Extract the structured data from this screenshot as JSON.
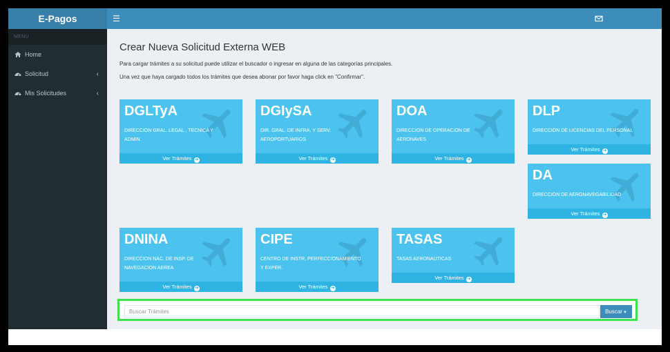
{
  "app": {
    "brand": "E-Pagos"
  },
  "header": {
    "toggle_icon": "hamburger-icon",
    "mail_icon": "envelope-icon"
  },
  "sidebar": {
    "menu_header": "MENU",
    "items": [
      {
        "label": "Home",
        "icon": "home-icon",
        "has_chevron": false
      },
      {
        "label": "Solicitud",
        "icon": "dashboard-icon",
        "has_chevron": true
      },
      {
        "label": "Mis Solicitudes",
        "icon": "dashboard-icon",
        "has_chevron": true
      }
    ],
    "chevron": "‹"
  },
  "main": {
    "title": "Crear Nueva Solicitud Externa WEB",
    "desc1": "Para cargar trámites a su solicitud puede utilizar el buscador o ingresar en alguna de las categorías principales.",
    "desc2": "Una vez que haya cargado todos los trámites que desea abonar por favor haga click en \"Confirmar\"."
  },
  "tiles": [
    {
      "code": "DGLTyA",
      "name": "DIRECCION GRAL. LEGAL , TECNICA Y ADMIN.",
      "link": "Ver Trámites"
    },
    {
      "code": "DGIySA",
      "name": "DIR. GRAL. DE INFRA. Y SERV. AEROPORTUARIOS",
      "link": "Ver Trámites"
    },
    {
      "code": "DOA",
      "name": "DIRECCION DE OPERACION DE AERONAVES",
      "link": "Ver Trámites"
    },
    {
      "code": "DLP",
      "name": "DIRECCION DE LICENCIAS DEL PERSONAL",
      "link": "Ver Trámites"
    },
    {
      "code": "DA",
      "name": "DIRECCION DE AERONAVEGABILIDAD",
      "link": "Ver Trámites"
    },
    {
      "code": "DNINA",
      "name": "DIRECCION NAC. DE INSP. DE NAVEGACION AEREA",
      "link": "Ver Trámites"
    },
    {
      "code": "CIPE",
      "name": "CENTRO DE INSTR, PERFECCIONAMIENTO Y EXPER.",
      "link": "Ver Trámites"
    },
    {
      "code": "TASAS",
      "name": "TASAS AERONAUTICAS",
      "link": "Ver Trámites"
    }
  ],
  "tile_icon": "airplane-icon",
  "search": {
    "placeholder": "Buscar Trámites",
    "value": "",
    "button_label": "Buscar"
  },
  "colors": {
    "tile": "#4cc3ee",
    "tile_footer": "#2fb3e3",
    "header": "#3c8dbc",
    "sidebar": "#222d32",
    "highlight": "#3ee24c"
  }
}
